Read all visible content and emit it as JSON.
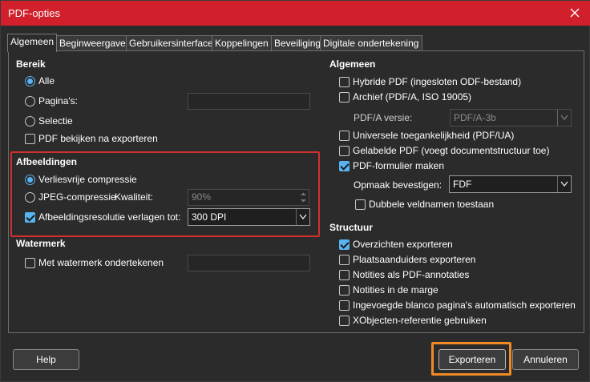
{
  "window": {
    "title": "PDF-opties"
  },
  "tabs": [
    "Algemeen",
    "Beginweergave",
    "Gebruikersinterface",
    "Koppelingen",
    "Beveiliging",
    "Digitale ondertekening"
  ],
  "bereik": {
    "heading": "Bereik",
    "alle": "Alle",
    "paginas": "Pagina's:",
    "paginas_value": "",
    "selectie": "Selectie",
    "pdf_bekijken": "PDF bekijken na exporteren"
  },
  "afbeeldingen": {
    "heading": "Afbeeldingen",
    "verliesvrij": "Verliesvrije compressie",
    "jpeg": "JPEG-compressie",
    "kwaliteit": "Kwaliteit:",
    "kwaliteit_value": "90%",
    "resolutie": "Afbeeldingsresolutie verlagen tot:",
    "resolutie_value": "300 DPI"
  },
  "watermerk": {
    "heading": "Watermerk",
    "ondertekenen": "Met watermerk ondertekenen",
    "value": ""
  },
  "algemeen": {
    "heading": "Algemeen",
    "hybride": "Hybride PDF (ingesloten ODF-bestand)",
    "archief": "Archief (PDF/A, ISO 19005)",
    "pdfa_versie": "PDF/A versie:",
    "pdfa_value": "PDF/A-3b",
    "universeel": "Universele toegankelijkheid (PDF/UA)",
    "gelabelde": "Gelabelde PDF (voegt documentstructuur toe)",
    "formulier": "PDF-formulier maken",
    "opmaak": "Opmaak bevestigen:",
    "opmaak_value": "FDF",
    "dubbele": "Dubbele veldnamen toestaan"
  },
  "structuur": {
    "heading": "Structuur",
    "overzichten": "Overzichten exporteren",
    "plaatsaanduiders": "Plaatsaanduiders exporteren",
    "notities_pdf": "Notities als PDF-annotaties",
    "notities_marge": "Notities in de marge",
    "blanco": "Ingevoegde blanco pagina's automatisch exporteren",
    "xobjecten": "XObjecten-referentie gebruiken"
  },
  "buttons": {
    "help": "Help",
    "exporteren": "Exporteren",
    "annuleren": "Annuleren"
  },
  "colors": {
    "titlebar": "#d1202b",
    "accent": "#58b4f0",
    "highlight_red": "#d32f2f",
    "highlight_orange": "#f08a24"
  }
}
